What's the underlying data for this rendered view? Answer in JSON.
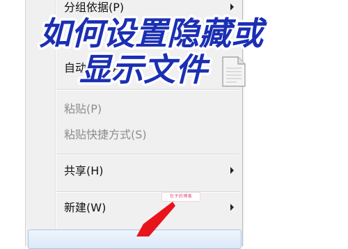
{
  "title_overlay": {
    "line1": "如何设置隐藏或",
    "line2": "显示文件",
    "stroke_color": "#ffffff",
    "fill_color": "#1b2fb3"
  },
  "menu": {
    "items": [
      {
        "label": "分组依据(P)",
        "has_submenu": true,
        "disabled": false
      },
      {
        "label": "自动排列(A)",
        "has_submenu": false,
        "disabled": false
      },
      {
        "label": "粘贴(P)",
        "has_submenu": false,
        "disabled": true
      },
      {
        "label": "粘贴快捷方式(S)",
        "has_submenu": false,
        "disabled": true
      },
      {
        "label": "共享(H)",
        "has_submenu": true,
        "disabled": false
      },
      {
        "label": "新建(W)",
        "has_submenu": true,
        "disabled": false
      }
    ]
  },
  "small_tag": "包子的博客",
  "colors": {
    "menu_bg": "#f0f0f0",
    "arrow_red": "#e8141b",
    "hover_border": "#a9c5e4"
  },
  "icons": [
    "submenu-arrow-icon",
    "document-icon",
    "red-pointer-arrow-icon"
  ]
}
